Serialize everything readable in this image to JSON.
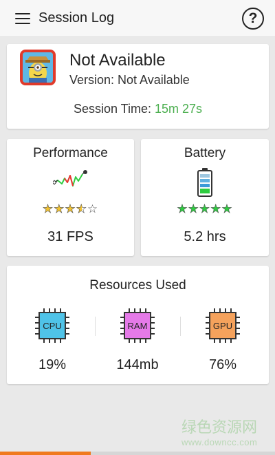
{
  "appbar": {
    "title": "Session Log",
    "menu_icon": "hamburger-menu-icon",
    "help_icon": "question-mark-icon",
    "help_glyph": "?"
  },
  "game": {
    "name": "Not Available",
    "version": "Version: Not Available",
    "session_label": "Session Time: ",
    "session_value": "15m 27s",
    "session_value_color": "#4caf50",
    "icon": "minion-game-icon"
  },
  "performance": {
    "title": "Performance",
    "icon": "fps-graph-icon",
    "rating": 3.5,
    "rating_max": 5,
    "value": "31 FPS"
  },
  "battery": {
    "title": "Battery",
    "icon": "battery-icon",
    "rating": 5,
    "rating_max": 5,
    "value": "5.2 hrs"
  },
  "resources": {
    "title": "Resources Used",
    "items": [
      {
        "label": "CPU",
        "value": "19%",
        "color": "#4fc3e8",
        "icon": "cpu-chip-icon"
      },
      {
        "label": "RAM",
        "value": "144mb",
        "color": "#e57ae8",
        "icon": "ram-chip-icon"
      },
      {
        "label": "GPU",
        "value": "76%",
        "color": "#f5a25c",
        "icon": "gpu-chip-icon"
      }
    ]
  },
  "session_progress": 0.33,
  "colors": {
    "accent": "#f07a1e",
    "star_gold": "#f2c230",
    "star_green": "#2ecc40"
  },
  "watermark": {
    "logo_text": "绿色资源网",
    "url": "www.downcc.com"
  }
}
